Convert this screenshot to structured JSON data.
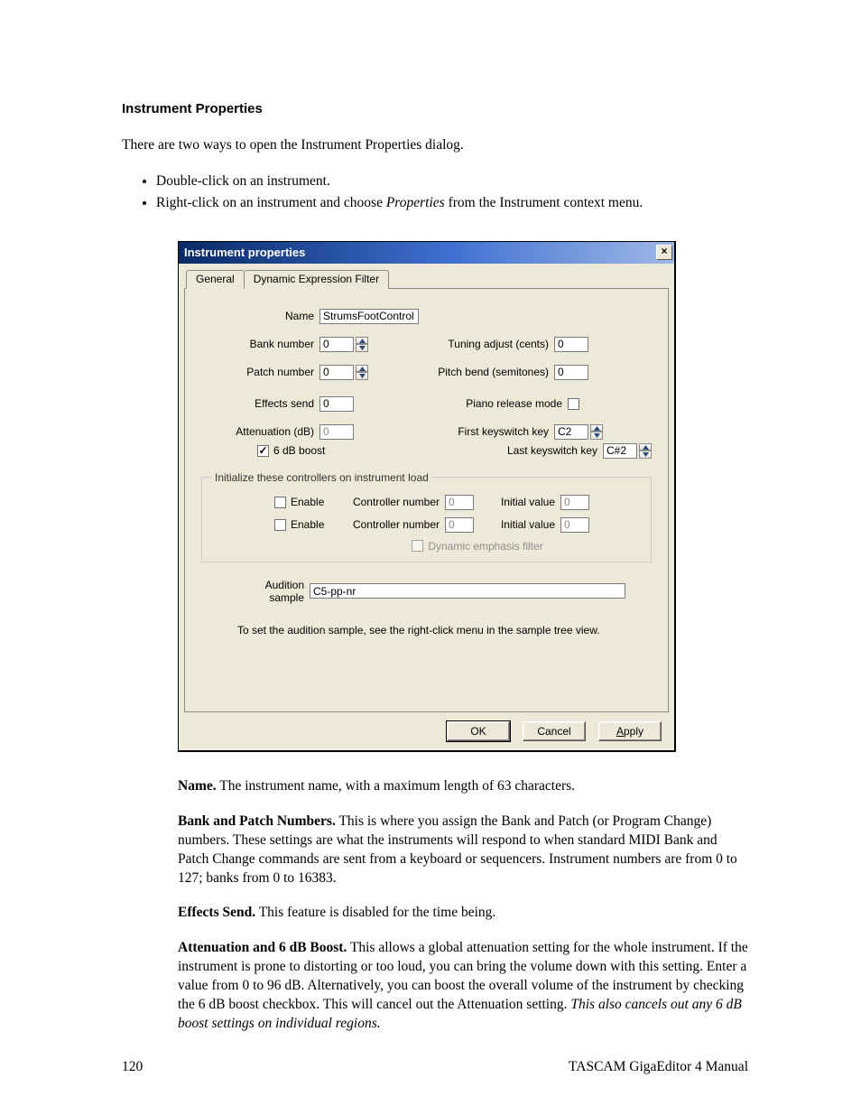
{
  "heading": "Instrument Properties",
  "intro": "There are two ways to open the Instrument Properties dialog.",
  "ways": [
    "Double-click on an instrument.",
    "Right-click on an instrument and choose "
  ],
  "ways_1_italic": "Properties",
  "ways_1_tail": " from the Instrument context menu.",
  "dialog": {
    "title": "Instrument properties",
    "close": "×",
    "tabs": {
      "general": "General",
      "def": "Dynamic Expression Filter"
    },
    "name_label": "Name",
    "name_value": "StrumsFootControl",
    "bank_label": "Bank number",
    "bank_value": "0",
    "patch_label": "Patch number",
    "patch_value": "0",
    "effects_label": "Effects send",
    "effects_value": "0",
    "atten_label": "Attenuation (dB)",
    "atten_value": "0",
    "boost_label": "6 dB boost",
    "tuning_label": "Tuning adjust (cents)",
    "tuning_value": "0",
    "pitch_label": "Pitch bend (semitones)",
    "pitch_value": "0",
    "piano_release_label": "Piano release mode",
    "first_ks_label": "First keyswitch key",
    "first_ks_value": "C2",
    "last_ks_label": "Last keyswitch key",
    "last_ks_value": "C#2",
    "group_legend": "Initialize these controllers on instrument load",
    "enable_label": "Enable",
    "ctrl_num_label": "Controller number",
    "ctrl_num_value": "0",
    "init_val_label": "Initial value",
    "init_val_value": "0",
    "def_chk_label": "Dynamic emphasis filter",
    "aud_label": "Audition sample",
    "aud_value": "C5-pp-nr",
    "aud_note": "To set the audition sample, see the right-click menu in the sample tree view.",
    "buttons": {
      "ok": "OK",
      "cancel": "Cancel",
      "apply_pre": "A",
      "apply_post": "pply"
    }
  },
  "expl": {
    "name_b": "Name.",
    "name_t": "  The instrument name, with a maximum length of 63 characters.",
    "bank_b": "Bank and Patch Numbers.",
    "bank_t": "  This is where you assign the Bank and Patch (or Program Change) numbers.  These settings are what the instruments will respond to when standard MIDI Bank and Patch Change commands are sent from a keyboard or sequencers.  Instrument numbers are from 0 to 127; banks from 0 to 16383.",
    "eff_b": "Effects Send.",
    "eff_t": "  This feature is disabled for the time being.",
    "att_b": "Attenuation and 6 dB Boost.",
    "att_t": "  This allows a global attenuation setting for the whole instrument.  If the instrument is prone to distorting or too loud, you can bring the volume down with this setting.  Enter a value from 0 to 96 dB.  Alternatively, you can boost the overall volume of the instrument by checking the 6 dB boost checkbox.  This will cancel out the Attenuation setting.  ",
    "att_i": "This also cancels out any 6 dB boost settings on individual regions."
  },
  "footer": {
    "page": "120",
    "title": "TASCAM GigaEditor 4 Manual"
  }
}
